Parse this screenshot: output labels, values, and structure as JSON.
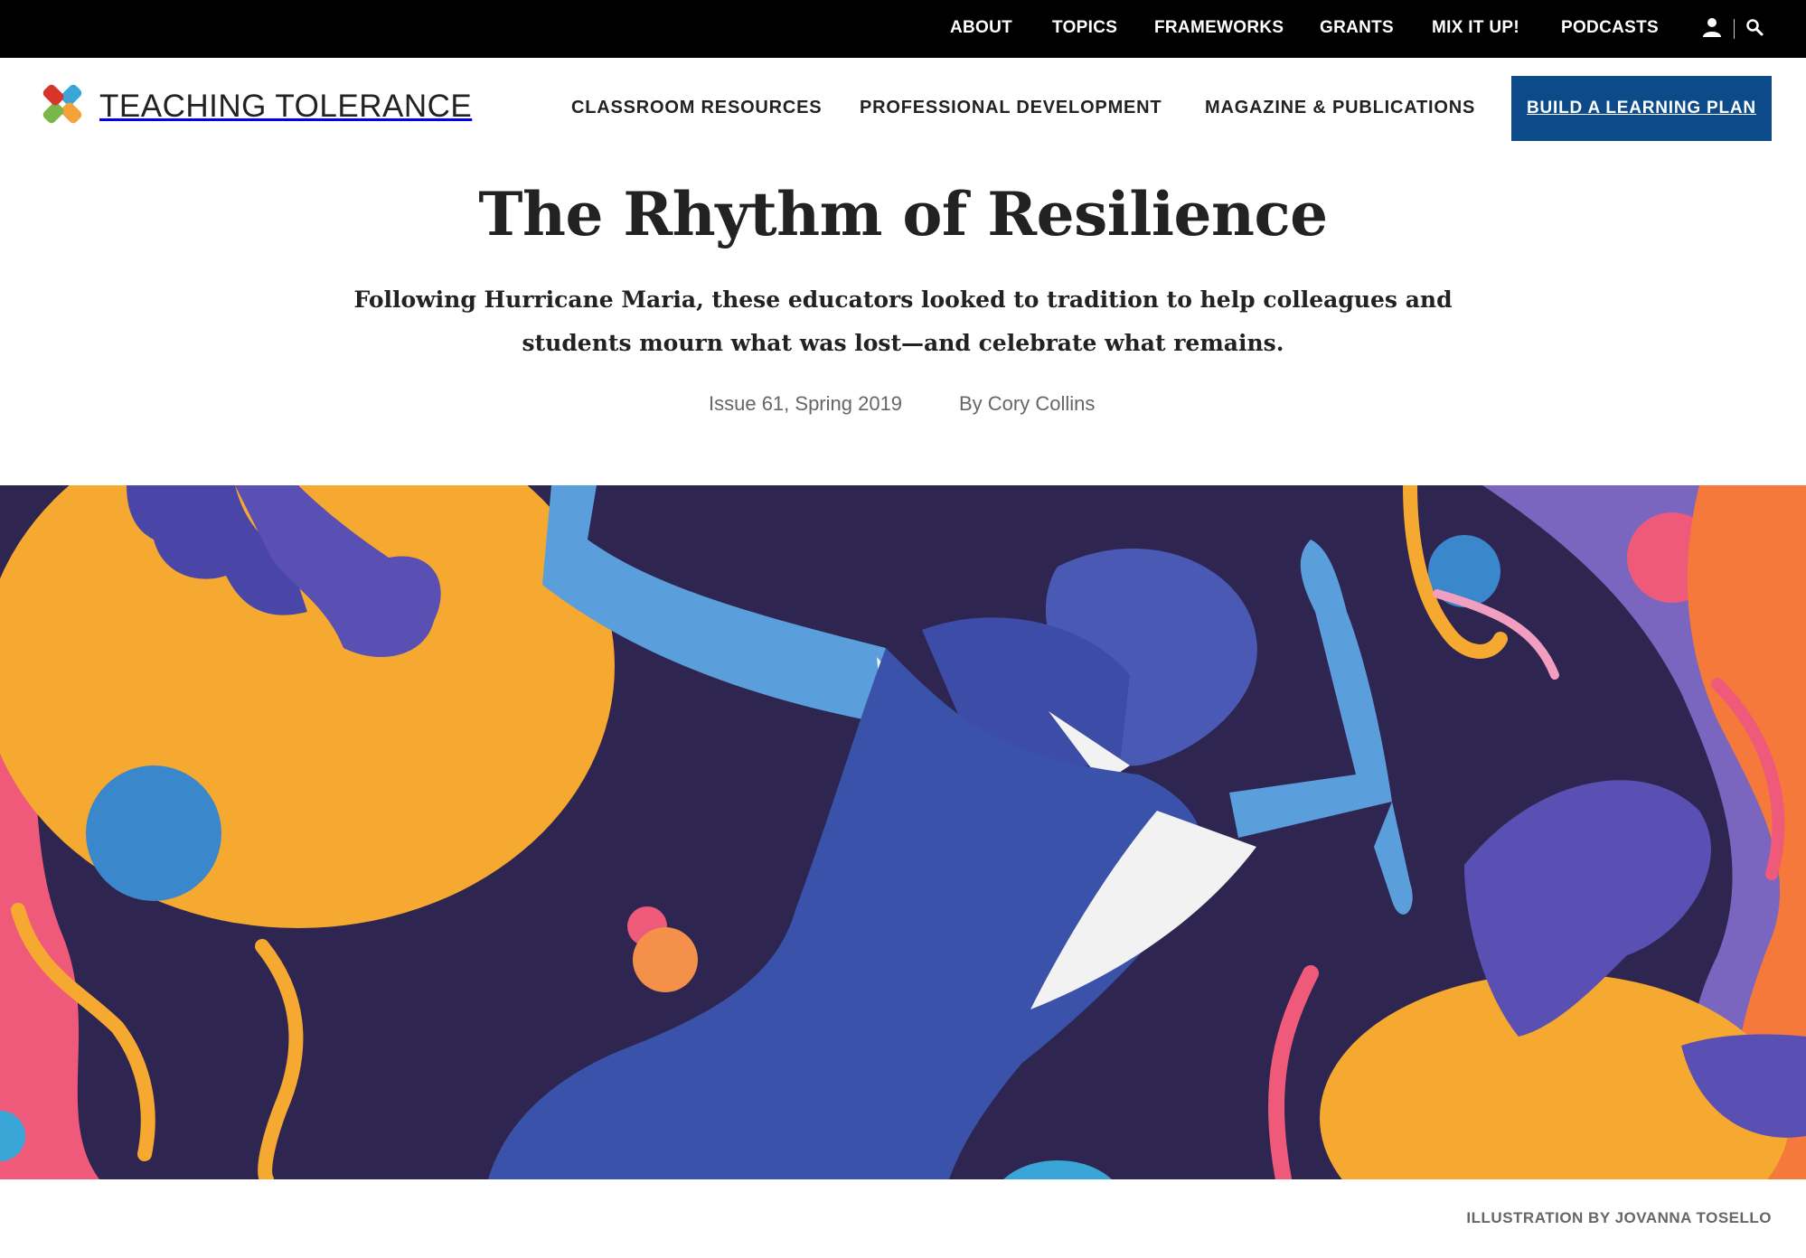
{
  "topbar": {
    "links": [
      "ABOUT",
      "TOPICS",
      "FRAMEWORKS",
      "GRANTS",
      "MIX IT UP!",
      "PODCASTS"
    ],
    "icons": [
      "user-icon",
      "search-icon"
    ]
  },
  "header": {
    "logo_text": "TEACHING TOLERANCE",
    "nav": [
      "CLASSROOM RESOURCES",
      "PROFESSIONAL DEVELOPMENT",
      "MAGAZINE & PUBLICATIONS"
    ],
    "cta_label": "BUILD A LEARNING PLAN",
    "cta_color": "#0d4a8a"
  },
  "article": {
    "title": "The Rhythm of Resilience",
    "dek": "Following Hurricane Maria, these educators looked to tradition to help colleagues and students mourn what was lost—and celebrate what remains.",
    "issue": "Issue 61, Spring 2019",
    "byline": "By Cory Collins",
    "image_credit": "ILLUSTRATION BY JOVANNA TOSELLO"
  },
  "colors": {
    "hero_background": "#2e2550",
    "orange": "#f6a930",
    "pink": "#ef5a7a",
    "blue": "#3a58ae",
    "light_blue": "#5a9edc",
    "purple": "#6a5db0"
  }
}
